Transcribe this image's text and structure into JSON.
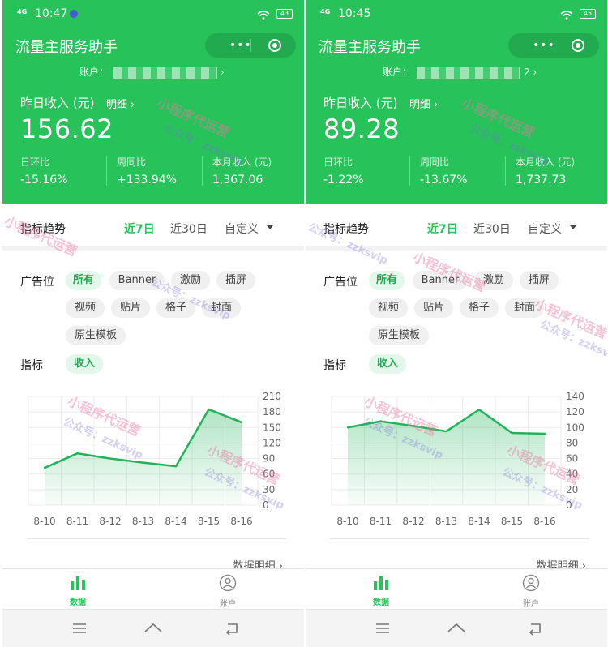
{
  "screens": [
    {
      "status": {
        "network": "4G",
        "time": "10:47",
        "battery": "43"
      },
      "app_title": "流量主服务助手",
      "capsule": {
        "more_icon": "•••",
        "close_icon": "target"
      },
      "account": {
        "label": "账户：",
        "suffix": ""
      },
      "income": {
        "label": "昨日收入 (元)",
        "detail_link": "明细 ›",
        "value": "156.62"
      },
      "stats": [
        {
          "label": "日环比",
          "value": "-15.16%"
        },
        {
          "label": "周同比",
          "value": "+133.94%"
        },
        {
          "label": "本月收入 (元)",
          "value": "1,367.06"
        }
      ],
      "trend": {
        "title": "指标趋势",
        "ranges": [
          "近7日",
          "近30日",
          "自定义"
        ],
        "active_range": "近7日"
      },
      "ad_position": {
        "label": "广告位",
        "chips": [
          "所有",
          "Banner",
          "激励",
          "插屏",
          "视频",
          "贴片",
          "格子",
          "封面",
          "原生模板"
        ],
        "active_chip": "所有"
      },
      "metric": {
        "label": "指标",
        "chip": "收入"
      },
      "chart_data": {
        "type": "area",
        "categories": [
          "8-10",
          "8-11",
          "8-12",
          "8-13",
          "8-14",
          "8-15",
          "8-16"
        ],
        "values": [
          72,
          100,
          90,
          82,
          75,
          185,
          160
        ],
        "yticks": [
          "210",
          "180",
          "150",
          "120",
          "90",
          "60",
          "30",
          "0"
        ],
        "ylim": [
          0,
          210
        ],
        "color": "#22b35a"
      },
      "data_detail": "数据明细 ›",
      "tabbar": [
        {
          "label": "数据",
          "icon": "bar-chart-icon"
        },
        {
          "label": "账户",
          "icon": "person-icon"
        }
      ],
      "watermarks": [
        "小程序代运营",
        "公众号：zzksvip"
      ]
    },
    {
      "status": {
        "network": "4G",
        "time": "10:45",
        "battery": "45"
      },
      "app_title": "流量主服务助手",
      "capsule": {
        "more_icon": "•••",
        "close_icon": "target"
      },
      "account": {
        "label": "账户：",
        "suffix": "2 ›"
      },
      "income": {
        "label": "昨日收入 (元)",
        "detail_link": "明细 ›",
        "value": "89.28"
      },
      "stats": [
        {
          "label": "日环比",
          "value": "-1.22%"
        },
        {
          "label": "周同比",
          "value": "-13.67%"
        },
        {
          "label": "本月收入 (元)",
          "value": "1,737.73"
        }
      ],
      "trend": {
        "title": "指标趋势",
        "ranges": [
          "近7日",
          "近30日",
          "自定义"
        ],
        "active_range": "近7日"
      },
      "ad_position": {
        "label": "广告位",
        "chips": [
          "所有",
          "Banner",
          "激励",
          "插屏",
          "视频",
          "贴片",
          "格子",
          "封面",
          "原生模板"
        ],
        "active_chip": "所有"
      },
      "metric": {
        "label": "指标",
        "chip": "收入"
      },
      "chart_data": {
        "type": "area",
        "categories": [
          "8-10",
          "8-11",
          "8-12",
          "8-13",
          "8-14",
          "8-15",
          "8-16"
        ],
        "values": [
          100,
          108,
          102,
          95,
          123,
          93,
          92
        ],
        "yticks": [
          "140",
          "120",
          "100",
          "80",
          "60",
          "40",
          "20",
          "0"
        ],
        "ylim": [
          0,
          140
        ],
        "color": "#22b35a"
      },
      "data_detail": "数据明细 ›",
      "tabbar": [
        {
          "label": "数据",
          "icon": "bar-chart-icon"
        },
        {
          "label": "账户",
          "icon": "person-icon"
        }
      ],
      "watermarks": [
        "小程序代运营",
        "公众号：zzksvip"
      ]
    }
  ]
}
